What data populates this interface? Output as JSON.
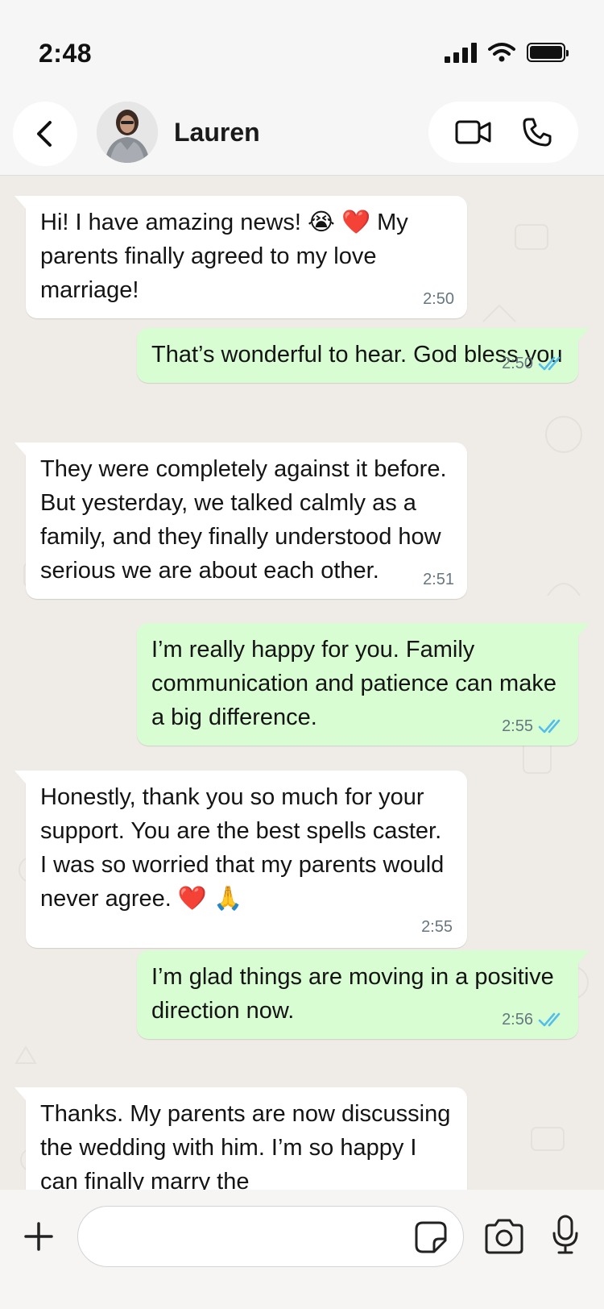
{
  "status_bar": {
    "time": "2:48"
  },
  "header": {
    "contact_name": "Lauren"
  },
  "colors": {
    "incoming_bubble": "#ffffff",
    "outgoing_bubble": "#d9fdd3",
    "read_ticks": "#53bdeb",
    "chat_background": "#efebe6"
  },
  "messages": [
    {
      "direction": "in",
      "text": "Hi! I have amazing news! 😭 ❤️  My parents finally agreed to my love marriage!",
      "time": "2:50"
    },
    {
      "direction": "out",
      "text": "That’s wonderful to hear. God bless you",
      "time": "2:50",
      "status": "read"
    },
    {
      "direction": "in",
      "text": "They were completely against it before. But yesterday, we talked calmly as a family, and they finally understood how serious we are about each other.",
      "time": "2:51"
    },
    {
      "direction": "out",
      "text": "I’m really happy for you. Family communication and patience can make a big difference.",
      "time": "2:55",
      "status": "read"
    },
    {
      "direction": "in",
      "text": "Honestly, thank you so much for your support. You are the best spells caster. I was so worried that my parents would never agree. ❤️ 🙏",
      "time": "2:55"
    },
    {
      "direction": "out",
      "text": "I’m glad things are moving in a positive direction now.",
      "time": "2:56",
      "status": "read"
    },
    {
      "direction": "in",
      "text": "Thanks. My parents are now discussing the wedding with him. I’m so happy I can finally marry the",
      "time": ""
    }
  ],
  "composer": {
    "placeholder": ""
  },
  "icons": {
    "back": "chevron-left-icon",
    "video": "video-call-icon",
    "call": "phone-icon",
    "add": "plus-icon",
    "sticker": "sticker-icon",
    "camera": "camera-icon",
    "mic": "microphone-icon",
    "read_receipt": "double-check-icon"
  }
}
